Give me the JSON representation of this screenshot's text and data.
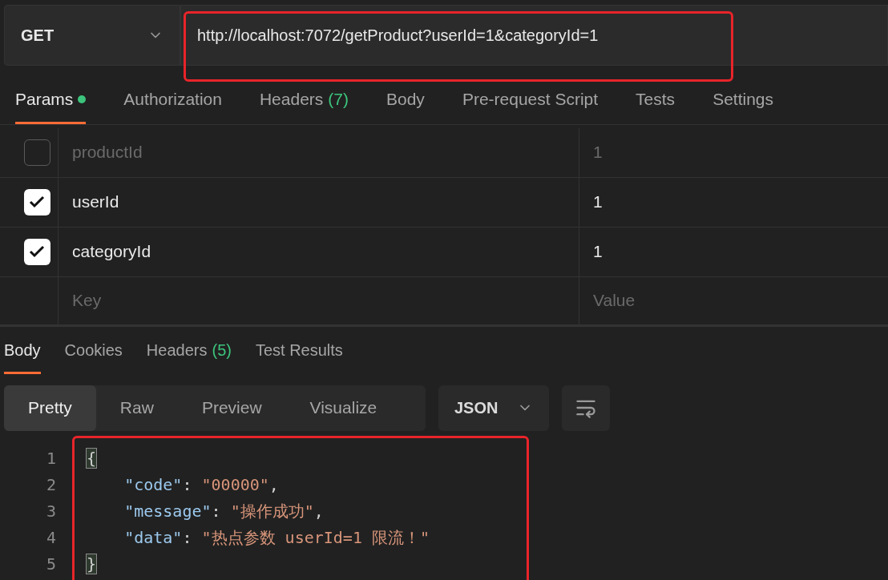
{
  "request": {
    "method": "GET",
    "url": "http://localhost:7072/getProduct?userId=1&categoryId=1",
    "url_highlighted": true
  },
  "request_tabs": [
    {
      "label": "Params",
      "dot": true,
      "selected": true
    },
    {
      "label": "Authorization",
      "selected": false
    },
    {
      "label": "Headers",
      "count": "(7)",
      "selected": false
    },
    {
      "label": "Body",
      "selected": false
    },
    {
      "label": "Pre-request Script",
      "selected": false
    },
    {
      "label": "Tests",
      "selected": false
    },
    {
      "label": "Settings",
      "selected": false
    }
  ],
  "params": {
    "rows": [
      {
        "key": "productId",
        "value": "1",
        "checked": false
      },
      {
        "key": "userId",
        "value": "1",
        "checked": true
      },
      {
        "key": "categoryId",
        "value": "1",
        "checked": true
      }
    ],
    "key_placeholder": "Key",
    "value_placeholder": "Value"
  },
  "response_tabs": [
    {
      "label": "Body",
      "selected": true
    },
    {
      "label": "Cookies",
      "selected": false
    },
    {
      "label": "Headers",
      "count": "(5)",
      "selected": false
    },
    {
      "label": "Test Results",
      "selected": false
    }
  ],
  "view_modes": [
    {
      "label": "Pretty",
      "selected": true
    },
    {
      "label": "Raw",
      "selected": false
    },
    {
      "label": "Preview",
      "selected": false
    },
    {
      "label": "Visualize",
      "selected": false
    }
  ],
  "format": "JSON",
  "code": {
    "highlighted": true,
    "lines": [
      {
        "number": "1",
        "tokens": [
          {
            "kind": "bracket",
            "text": "{"
          }
        ]
      },
      {
        "number": "2",
        "tokens": [
          {
            "kind": "key",
            "text": "    \"code\""
          },
          {
            "kind": "punct",
            "text": ": "
          },
          {
            "kind": "string",
            "text": "\"00000\""
          },
          {
            "kind": "punct",
            "text": ","
          }
        ]
      },
      {
        "number": "3",
        "tokens": [
          {
            "kind": "key",
            "text": "    \"message\""
          },
          {
            "kind": "punct",
            "text": ": "
          },
          {
            "kind": "string",
            "text": "\"操作成功\""
          },
          {
            "kind": "punct",
            "text": ","
          }
        ]
      },
      {
        "number": "4",
        "tokens": [
          {
            "kind": "key",
            "text": "    \"data\""
          },
          {
            "kind": "punct",
            "text": ": "
          },
          {
            "kind": "string",
            "text": "\"热点参数 userId=1 限流！\""
          }
        ]
      },
      {
        "number": "5",
        "tokens": [
          {
            "kind": "bracket",
            "text": "}"
          }
        ]
      }
    ]
  }
}
